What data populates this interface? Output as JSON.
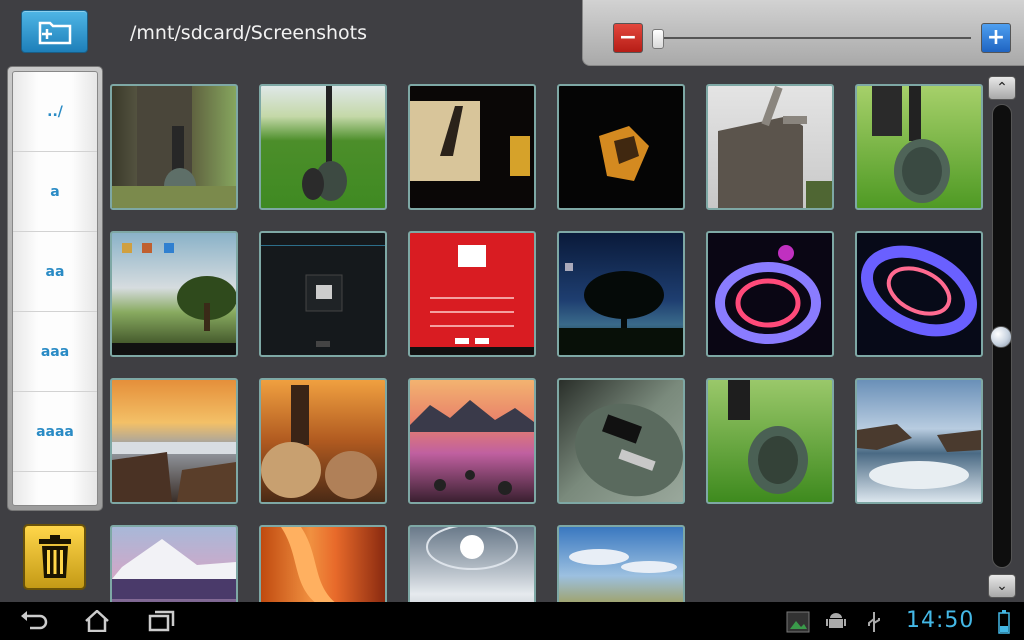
{
  "header": {
    "path": "/mnt/sdcard/Screenshots"
  },
  "zoom": {
    "minus_label": "−",
    "plus_label": "+",
    "level": 0.0
  },
  "sidebar": {
    "items": [
      {
        "label": "../"
      },
      {
        "label": "a"
      },
      {
        "label": "aa"
      },
      {
        "label": "aaa"
      },
      {
        "label": "aaaa"
      }
    ]
  },
  "icons": {
    "new_folder": "new-folder-icon",
    "trash": "trash-icon",
    "back": "back-icon",
    "home": "home-icon",
    "recent": "recent-apps-icon"
  },
  "thumbnails": [
    {
      "name": "tree-guitar"
    },
    {
      "name": "grass-guitar"
    },
    {
      "name": "dark-hand"
    },
    {
      "name": "night-cube"
    },
    {
      "name": "windmill"
    },
    {
      "name": "guitar-grass-closeup"
    },
    {
      "name": "homescreen-screenshot"
    },
    {
      "name": "dark-dialog-screenshot"
    },
    {
      "name": "red-form-screenshot"
    },
    {
      "name": "tree-night-screenshot"
    },
    {
      "name": "light-spinner-figure"
    },
    {
      "name": "light-spinner-disc"
    },
    {
      "name": "sunset-waterfall"
    },
    {
      "name": "cactus-sunset"
    },
    {
      "name": "mountain-reflection"
    },
    {
      "name": "guitar-pickups"
    },
    {
      "name": "guitar-grass-2"
    },
    {
      "name": "ocean-rocks"
    },
    {
      "name": "snow-mountain"
    },
    {
      "name": "orange-canyon"
    },
    {
      "name": "icy-sun"
    },
    {
      "name": "meadow-sky"
    }
  ],
  "status": {
    "time": "14:50"
  }
}
